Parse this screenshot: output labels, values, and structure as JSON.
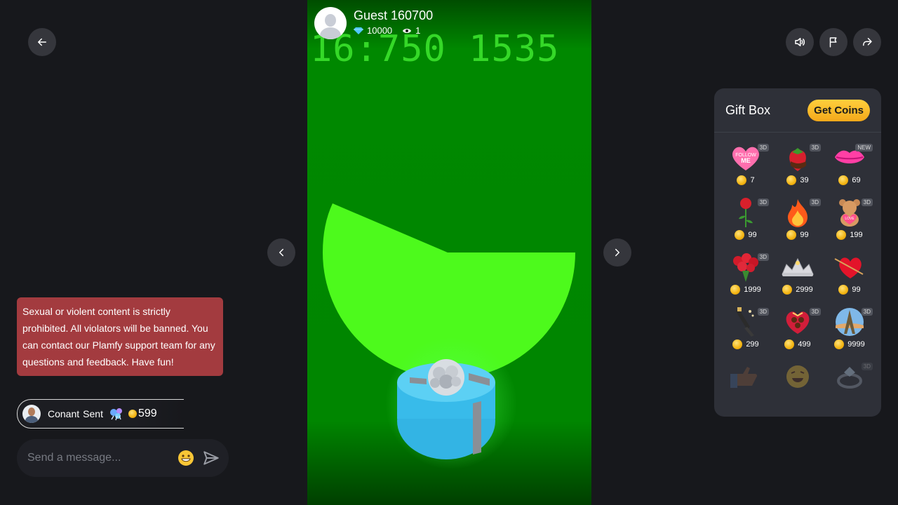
{
  "streamer": {
    "name": "Guest 160700",
    "diamonds": "10000",
    "viewers": "1"
  },
  "stream_overlay_text": "16:750 1535",
  "gift_box": {
    "title": "Gift Box",
    "get_coins_label": "Get Coins",
    "items": [
      {
        "icon": "follow-me-heart-icon",
        "badge": "3D",
        "price": "7"
      },
      {
        "icon": "strawberry-icon",
        "badge": "3D",
        "price": "39"
      },
      {
        "icon": "lips-icon",
        "badge": "NEW",
        "price": "69"
      },
      {
        "icon": "rose-icon",
        "badge": "3D",
        "price": "99"
      },
      {
        "icon": "fire-icon",
        "badge": "3D",
        "price": "99"
      },
      {
        "icon": "teddy-bear-icon",
        "badge": "3D",
        "price": "199"
      },
      {
        "icon": "rose-bouquet-icon",
        "badge": "3D",
        "price": "1999"
      },
      {
        "icon": "tiara-icon",
        "badge": "",
        "price": "2999"
      },
      {
        "icon": "heart-arrow-icon",
        "badge": "",
        "price": "99"
      },
      {
        "icon": "champagne-icon",
        "badge": "3D",
        "price": "299"
      },
      {
        "icon": "heart-chocolate-box-icon",
        "badge": "3D",
        "price": "499"
      },
      {
        "icon": "eiffel-tower-icon",
        "badge": "3D",
        "price": "9999"
      },
      {
        "icon": "hand-icon",
        "badge": "",
        "price": ""
      },
      {
        "icon": "laughing-face-icon",
        "badge": "",
        "price": ""
      },
      {
        "icon": "ring-icon",
        "badge": "3D",
        "price": ""
      }
    ]
  },
  "chat": {
    "notice": "Sexual or violent content is strictly prohibited. All violators will be banned. You can contact our Plamfy support team for any questions and feedback. Have fun!",
    "sent": {
      "user": "Conant",
      "action": "Sent",
      "amount": "599"
    },
    "input_placeholder": "Send a message..."
  },
  "colors": {
    "notice_bg": "#a33b3f",
    "accent_coin": "#f4a81a",
    "stream_green": "#008800"
  }
}
